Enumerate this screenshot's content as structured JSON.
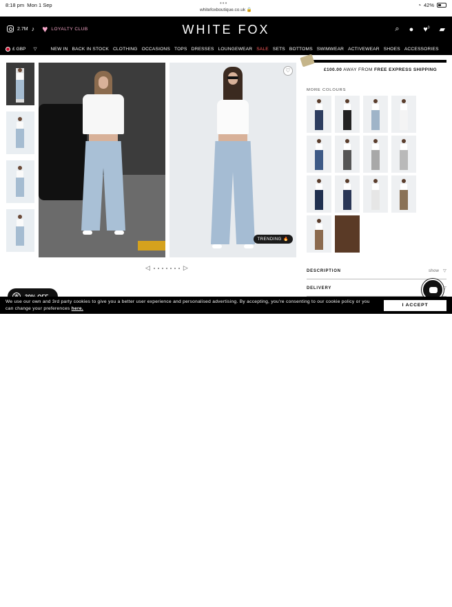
{
  "status_bar": {
    "time": "8:18 pm",
    "date": "Mon 1 Sep",
    "url": "whitefoxboutique.co.uk",
    "battery": "42%",
    "battery_level": 0.42
  },
  "header": {
    "followers": "2.7M",
    "loyalty": "LOYALTY CLUB",
    "logo": "WHITE FOX",
    "bag_count": "0",
    "icons": [
      "instagram-icon",
      "tiktok-icon",
      "heart-icon",
      "search-icon",
      "account-icon",
      "wishlist-icon",
      "bag-icon"
    ]
  },
  "nav": {
    "currency": "£ GBP",
    "items": [
      "NEW IN",
      "BACK IN STOCK",
      "CLOTHING",
      "OCCASIONS",
      "TOPS",
      "DRESSES",
      "LOUNGEWEAR",
      "SALE",
      "SETS",
      "BOTTOMS",
      "SWIMWEAR",
      "ACTIVEWEAR",
      "SHOES",
      "ACCESSORIES"
    ]
  },
  "gallery": {
    "badge": "TRENDING",
    "pager_dots": 7,
    "thumbnail_count": 4
  },
  "product": {
    "shipping_amount": "£100.00",
    "shipping_text": "AWAY FROM",
    "shipping_bold": "FREE EXPRESS SHIPPING",
    "shipping_progress": 1.0,
    "more_colours_label": "MORE COLOURS",
    "swatch_colors": [
      "#2d3d5f",
      "#222222",
      "#9fb4c8",
      "#f4f4f4",
      "#3e5a86",
      "#555555",
      "#a8a8a8",
      "#b9b9b9",
      "#20304f",
      "#2a3656",
      "#e6e6e6",
      "#8a7256",
      "#8b6a4e",
      "#5a3a26"
    ],
    "description_label": "DESCRIPTION",
    "description_toggle": "show",
    "delivery_label": "DELIVERY"
  },
  "promo": {
    "label": "30% OFF"
  },
  "cookie": {
    "text_pre": "We use our own and 3rd party cookies to give you a better user experience and personalised advertising. By accepting, you're consenting to our cookie policy or you can change your preferences",
    "link": "here.",
    "accept_label": "I ACCEPT"
  }
}
